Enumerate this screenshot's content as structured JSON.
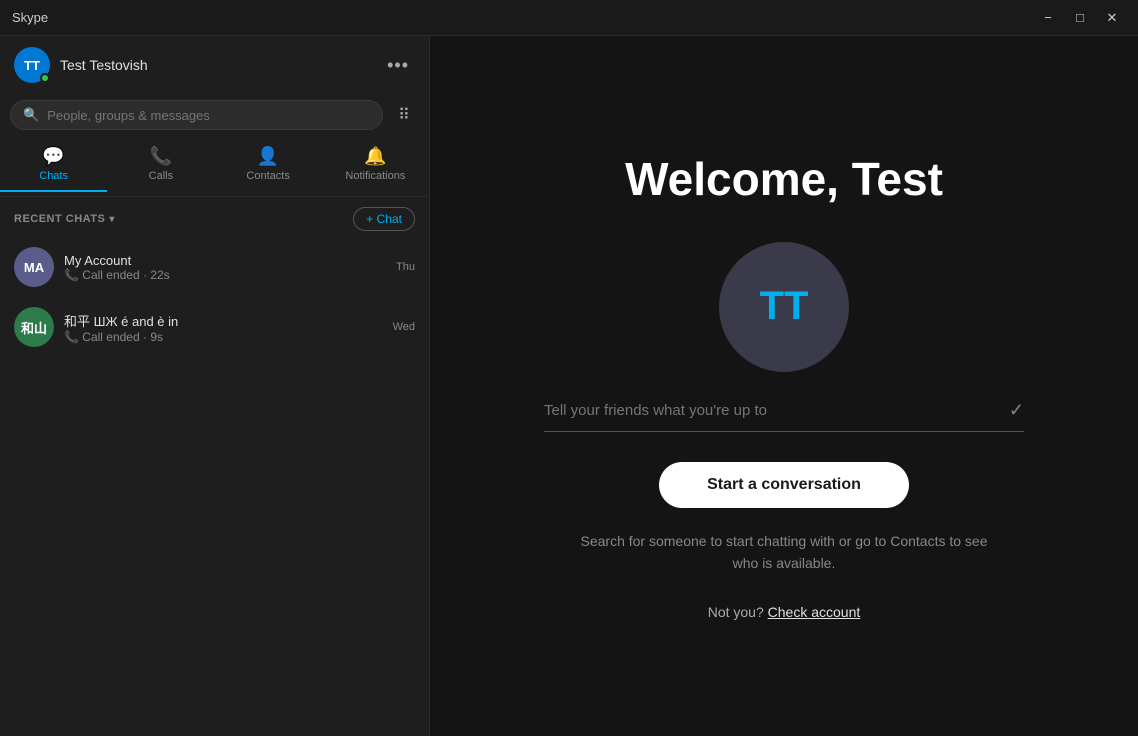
{
  "titleBar": {
    "title": "Skype",
    "minimizeLabel": "−",
    "maximizeLabel": "□",
    "closeLabel": "✕"
  },
  "sidebar": {
    "profile": {
      "initials": "TT",
      "name": "Test Testovish",
      "moreBtn": "•••"
    },
    "search": {
      "placeholder": "People, groups & messages"
    },
    "tabs": [
      {
        "id": "chats",
        "label": "Chats",
        "icon": "💬",
        "active": true
      },
      {
        "id": "calls",
        "label": "Calls",
        "icon": "📞",
        "active": false
      },
      {
        "id": "contacts",
        "label": "Contacts",
        "icon": "👤",
        "active": false
      },
      {
        "id": "notifications",
        "label": "Notifications",
        "icon": "🔔",
        "active": false
      }
    ],
    "recentChatsLabel": "RECENT CHATS",
    "newChatLabel": "+ Chat",
    "chats": [
      {
        "id": "my-account",
        "initials": "MA",
        "colorClass": "ma",
        "name": "My Account",
        "preview": "📞 Call ended · 22s",
        "time": "Thu"
      },
      {
        "id": "ws-chat",
        "initials": "和山",
        "colorClass": "ws",
        "name": "和平 ШЖ é and è in",
        "preview": "📞 Call ended · 9s",
        "time": "Wed"
      }
    ]
  },
  "main": {
    "welcomeTitle": "Welcome, Test",
    "avatarInitials": "TT",
    "statusPlaceholder": "Tell your friends what you're up to",
    "startBtnLabel": "Start a conversation",
    "subText": "Search for someone to start chatting with or go to Contacts to see who is available.",
    "notYouText": "Not you?",
    "checkAccountLabel": "Check account"
  }
}
